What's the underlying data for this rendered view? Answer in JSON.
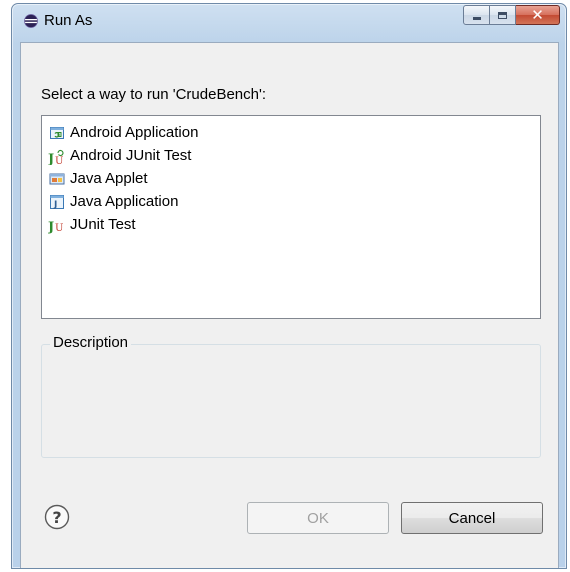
{
  "window": {
    "title": "Run As",
    "controls": {
      "minimize_icon": "minimize-icon",
      "maximize_icon": "maximize-icon",
      "close_icon": "close-icon"
    }
  },
  "dialog": {
    "prompt": "Select a way to run 'CrudeBench':",
    "launch_options": [
      {
        "label": "Android Application",
        "icon": "android-application-icon"
      },
      {
        "label": "Android JUnit Test",
        "icon": "android-junit-icon"
      },
      {
        "label": "Java Applet",
        "icon": "java-applet-icon"
      },
      {
        "label": "Java Application",
        "icon": "java-application-icon"
      },
      {
        "label": "JUnit Test",
        "icon": "junit-icon"
      }
    ],
    "description_label": "Description",
    "description_text": ""
  },
  "buttons": {
    "help_icon": "help-icon",
    "ok_label": "OK",
    "ok_enabled": false,
    "cancel_label": "Cancel"
  },
  "colors": {
    "title_gradient": "#bcd3ea",
    "close_button": "#c34a33",
    "client_bg": "#f0f0f0",
    "junit_green": "#2e8b2e",
    "junit_red": "#c0392b"
  }
}
